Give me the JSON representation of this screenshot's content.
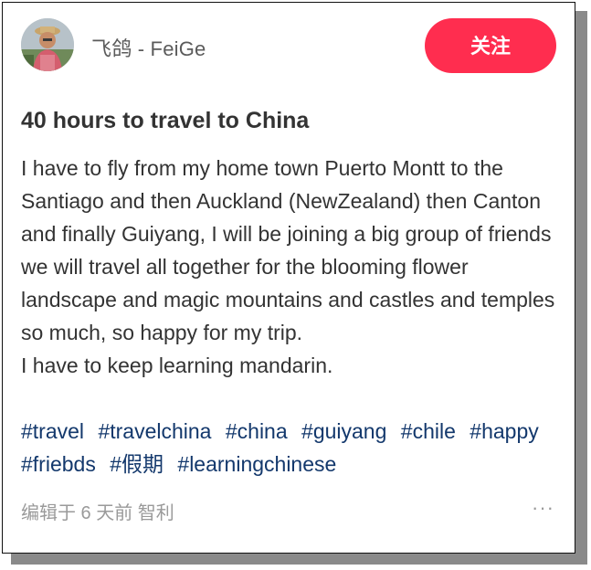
{
  "author": {
    "name": "飞鸽 - FeiGe",
    "follow_label": "关注"
  },
  "post": {
    "title": "40 hours to travel to China",
    "lines": [
      "I have to fly from my home town Puerto Montt to the Santiago and then Auckland (NewZealand) then Canton and finally Guiyang, I will be joining a big group of friends we will travel all together for the blooming flower landscape and magic mountains and castles and temples so much, so happy for my trip.",
      "I have to keep learning mandarin."
    ],
    "tags": [
      "#travel",
      "#travelchina",
      "#china",
      "#guiyang",
      "#chile",
      "#happy",
      "#friebds",
      "#假期",
      "#learningchinese"
    ]
  },
  "footer": {
    "meta": "编辑于 6 天前 智利",
    "more_icon": "ellipsis-icon",
    "more_glyph": "···"
  },
  "colors": {
    "accent": "#ff2d4f",
    "tag": "#13386c",
    "text": "#333333",
    "muted": "#9a9a9a"
  }
}
